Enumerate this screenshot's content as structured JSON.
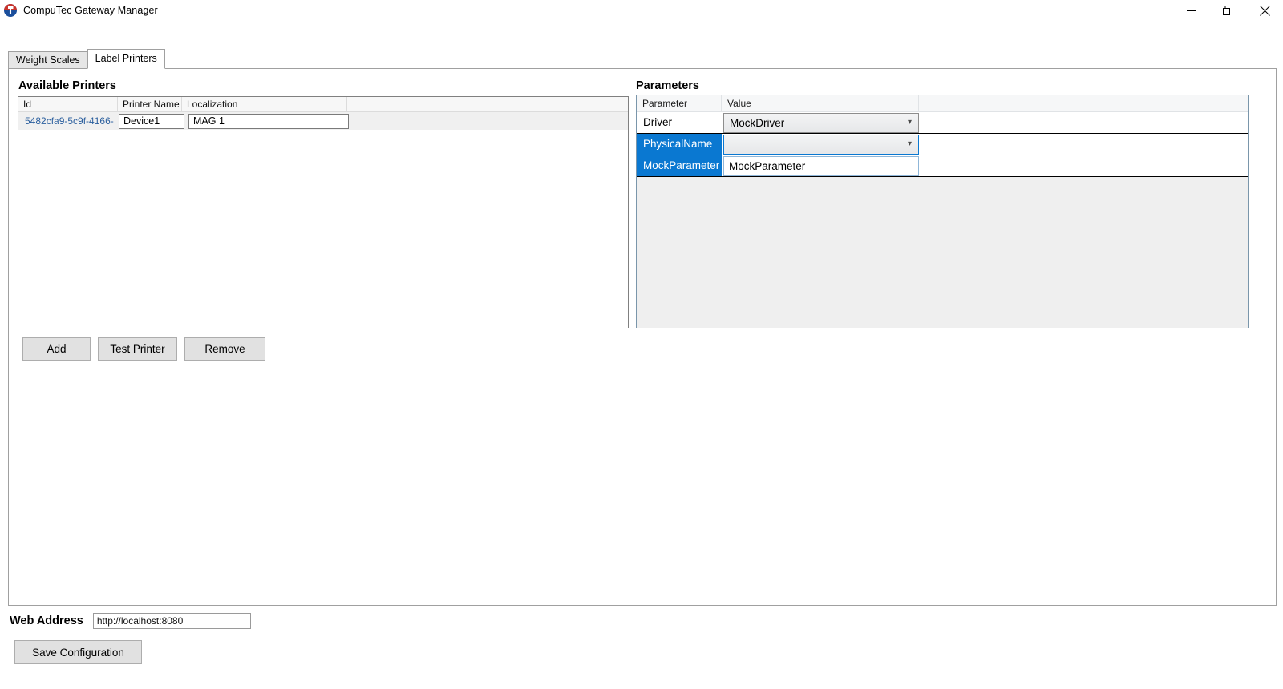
{
  "window": {
    "title": "CompuTec Gateway Manager",
    "icon": "app-logo-icon",
    "controls": {
      "minimize": "minimize-icon",
      "restore": "restore-icon",
      "close": "close-icon"
    }
  },
  "tabs": [
    {
      "label": "Weight Scales",
      "active": false
    },
    {
      "label": "Label Printers",
      "active": true
    }
  ],
  "printers": {
    "heading": "Available Printers",
    "columns": [
      "Id",
      "Printer Name",
      "Localization",
      ""
    ],
    "rows": [
      {
        "id": "5482cfa9-5c9f-4166-",
        "printer_name": "Device1",
        "localization": "MAG 1"
      }
    ],
    "buttons": {
      "add": "Add",
      "test": "Test Printer",
      "remove": "Remove"
    }
  },
  "parameters": {
    "heading": "Parameters",
    "columns": [
      "Parameter",
      "Value",
      ""
    ],
    "rows": [
      {
        "name": "Driver",
        "value": "MockDriver",
        "editor": "combo",
        "selected": false,
        "focused": false
      },
      {
        "name": "PhysicalName",
        "value": "",
        "editor": "combo",
        "selected": true,
        "focused": true
      },
      {
        "name": "MockParameter",
        "value": "MockParameter",
        "editor": "text",
        "selected": true,
        "focused": false
      }
    ]
  },
  "footer": {
    "web_address_label": "Web Address",
    "web_address_value": "http://localhost:8080",
    "web_address_placeholder": "http://localhost:8080",
    "save_button": "Save Configuration"
  },
  "colors": {
    "selection_blue": "#0a78d1",
    "id_link": "#2b5f9e",
    "button_face": "#e1e1e1",
    "grid_body": "#efefef"
  }
}
